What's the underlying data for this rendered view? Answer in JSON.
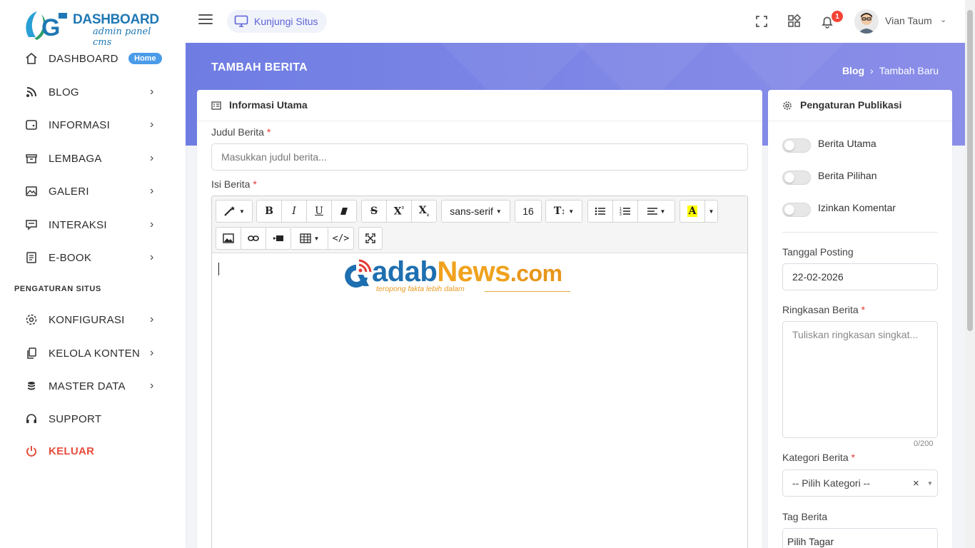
{
  "logo": {
    "title": "DASHBOARD",
    "subtitle": "admin panel cms"
  },
  "sidebar": {
    "items": [
      {
        "label": "DASHBOARD",
        "icon": "home-icon",
        "badge": "Home"
      },
      {
        "label": "BLOG",
        "icon": "rss-icon"
      },
      {
        "label": "INFORMASI",
        "icon": "wallet-icon"
      },
      {
        "label": "LEMBAGA",
        "icon": "inbox-icon"
      },
      {
        "label": "GALERI",
        "icon": "image-icon"
      },
      {
        "label": "INTERAKSI",
        "icon": "message-icon"
      },
      {
        "label": "E-BOOK",
        "icon": "notebook-icon"
      }
    ],
    "section": "PENGATURAN SITUS",
    "settings": [
      {
        "label": "KONFIGURASI",
        "icon": "gear-icon"
      },
      {
        "label": "KELOLA KONTEN",
        "icon": "copy-icon"
      },
      {
        "label": "MASTER DATA",
        "icon": "database-icon"
      },
      {
        "label": "SUPPORT",
        "icon": "headphones-icon"
      },
      {
        "label": "KELUAR",
        "icon": "power-icon"
      }
    ]
  },
  "topbar": {
    "visit_label": "Kunjungi Situs",
    "notif_count": "1",
    "username": "Vian Taum"
  },
  "page": {
    "title": "TAMBAH BERITA",
    "breadcrumb": [
      "Blog",
      "Tambah Baru"
    ]
  },
  "main_card": {
    "title": "Informasi Utama",
    "judul_label": "Judul Berita",
    "judul_placeholder": "Masukkan judul berita...",
    "isi_label": "Isi Berita",
    "required_mark": "*",
    "toolbar": {
      "font_family": "sans-serif",
      "font_size": "16"
    },
    "editor_brand": {
      "name_a": "adab",
      "name_news": "News",
      "name_com": ".com",
      "tagline": "teropong fakta lebih dalam"
    }
  },
  "side_card": {
    "title": "Pengaturan Publikasi",
    "toggles": [
      "Berita Utama",
      "Berita Pilihan",
      "Izinkan Komentar"
    ],
    "tanggal_label": "Tanggal Posting",
    "tanggal_value": "22-02-2026",
    "ringkasan_label": "Ringkasan Berita",
    "ringkasan_placeholder": "Tuliskan ringkasan singkat...",
    "ringkasan_counter": "0/200",
    "kategori_label": "Kategori Berita",
    "kategori_value": "-- Pilih Kategori --",
    "clear_mark": "×",
    "tag_label": "Tag Berita",
    "tag_value": "Pilih Tagar"
  },
  "colors": {
    "accent": "#6f7de3",
    "primary": "#5b63d6",
    "danger": "#e74c3c",
    "badge": "#4a9be8"
  }
}
